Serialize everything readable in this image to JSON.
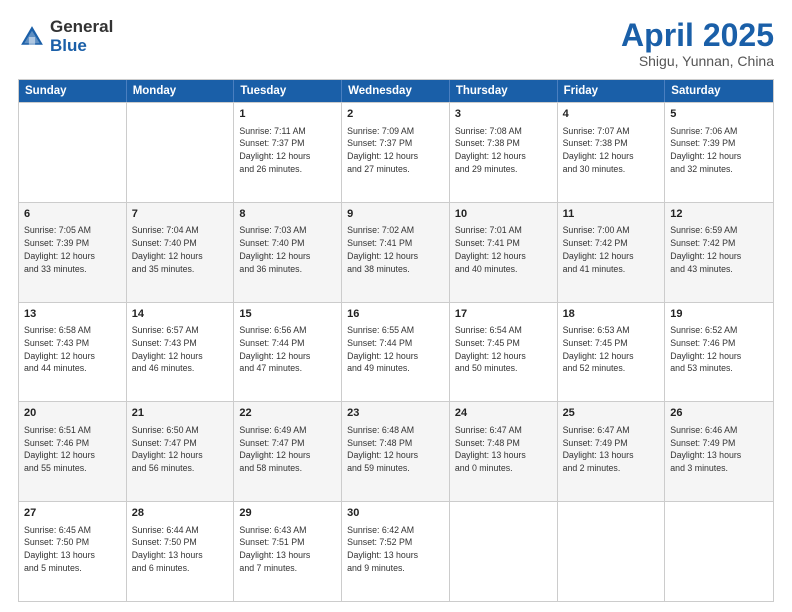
{
  "logo": {
    "general": "General",
    "blue": "Blue"
  },
  "title": {
    "month": "April 2025",
    "location": "Shigu, Yunnan, China"
  },
  "header_days": [
    "Sunday",
    "Monday",
    "Tuesday",
    "Wednesday",
    "Thursday",
    "Friday",
    "Saturday"
  ],
  "rows": [
    {
      "alt": false,
      "cells": [
        {
          "day": "",
          "text": ""
        },
        {
          "day": "",
          "text": ""
        },
        {
          "day": "1",
          "text": "Sunrise: 7:11 AM\nSunset: 7:37 PM\nDaylight: 12 hours\nand 26 minutes."
        },
        {
          "day": "2",
          "text": "Sunrise: 7:09 AM\nSunset: 7:37 PM\nDaylight: 12 hours\nand 27 minutes."
        },
        {
          "day": "3",
          "text": "Sunrise: 7:08 AM\nSunset: 7:38 PM\nDaylight: 12 hours\nand 29 minutes."
        },
        {
          "day": "4",
          "text": "Sunrise: 7:07 AM\nSunset: 7:38 PM\nDaylight: 12 hours\nand 30 minutes."
        },
        {
          "day": "5",
          "text": "Sunrise: 7:06 AM\nSunset: 7:39 PM\nDaylight: 12 hours\nand 32 minutes."
        }
      ]
    },
    {
      "alt": true,
      "cells": [
        {
          "day": "6",
          "text": "Sunrise: 7:05 AM\nSunset: 7:39 PM\nDaylight: 12 hours\nand 33 minutes."
        },
        {
          "day": "7",
          "text": "Sunrise: 7:04 AM\nSunset: 7:40 PM\nDaylight: 12 hours\nand 35 minutes."
        },
        {
          "day": "8",
          "text": "Sunrise: 7:03 AM\nSunset: 7:40 PM\nDaylight: 12 hours\nand 36 minutes."
        },
        {
          "day": "9",
          "text": "Sunrise: 7:02 AM\nSunset: 7:41 PM\nDaylight: 12 hours\nand 38 minutes."
        },
        {
          "day": "10",
          "text": "Sunrise: 7:01 AM\nSunset: 7:41 PM\nDaylight: 12 hours\nand 40 minutes."
        },
        {
          "day": "11",
          "text": "Sunrise: 7:00 AM\nSunset: 7:42 PM\nDaylight: 12 hours\nand 41 minutes."
        },
        {
          "day": "12",
          "text": "Sunrise: 6:59 AM\nSunset: 7:42 PM\nDaylight: 12 hours\nand 43 minutes."
        }
      ]
    },
    {
      "alt": false,
      "cells": [
        {
          "day": "13",
          "text": "Sunrise: 6:58 AM\nSunset: 7:43 PM\nDaylight: 12 hours\nand 44 minutes."
        },
        {
          "day": "14",
          "text": "Sunrise: 6:57 AM\nSunset: 7:43 PM\nDaylight: 12 hours\nand 46 minutes."
        },
        {
          "day": "15",
          "text": "Sunrise: 6:56 AM\nSunset: 7:44 PM\nDaylight: 12 hours\nand 47 minutes."
        },
        {
          "day": "16",
          "text": "Sunrise: 6:55 AM\nSunset: 7:44 PM\nDaylight: 12 hours\nand 49 minutes."
        },
        {
          "day": "17",
          "text": "Sunrise: 6:54 AM\nSunset: 7:45 PM\nDaylight: 12 hours\nand 50 minutes."
        },
        {
          "day": "18",
          "text": "Sunrise: 6:53 AM\nSunset: 7:45 PM\nDaylight: 12 hours\nand 52 minutes."
        },
        {
          "day": "19",
          "text": "Sunrise: 6:52 AM\nSunset: 7:46 PM\nDaylight: 12 hours\nand 53 minutes."
        }
      ]
    },
    {
      "alt": true,
      "cells": [
        {
          "day": "20",
          "text": "Sunrise: 6:51 AM\nSunset: 7:46 PM\nDaylight: 12 hours\nand 55 minutes."
        },
        {
          "day": "21",
          "text": "Sunrise: 6:50 AM\nSunset: 7:47 PM\nDaylight: 12 hours\nand 56 minutes."
        },
        {
          "day": "22",
          "text": "Sunrise: 6:49 AM\nSunset: 7:47 PM\nDaylight: 12 hours\nand 58 minutes."
        },
        {
          "day": "23",
          "text": "Sunrise: 6:48 AM\nSunset: 7:48 PM\nDaylight: 12 hours\nand 59 minutes."
        },
        {
          "day": "24",
          "text": "Sunrise: 6:47 AM\nSunset: 7:48 PM\nDaylight: 13 hours\nand 0 minutes."
        },
        {
          "day": "25",
          "text": "Sunrise: 6:47 AM\nSunset: 7:49 PM\nDaylight: 13 hours\nand 2 minutes."
        },
        {
          "day": "26",
          "text": "Sunrise: 6:46 AM\nSunset: 7:49 PM\nDaylight: 13 hours\nand 3 minutes."
        }
      ]
    },
    {
      "alt": false,
      "cells": [
        {
          "day": "27",
          "text": "Sunrise: 6:45 AM\nSunset: 7:50 PM\nDaylight: 13 hours\nand 5 minutes."
        },
        {
          "day": "28",
          "text": "Sunrise: 6:44 AM\nSunset: 7:50 PM\nDaylight: 13 hours\nand 6 minutes."
        },
        {
          "day": "29",
          "text": "Sunrise: 6:43 AM\nSunset: 7:51 PM\nDaylight: 13 hours\nand 7 minutes."
        },
        {
          "day": "30",
          "text": "Sunrise: 6:42 AM\nSunset: 7:52 PM\nDaylight: 13 hours\nand 9 minutes."
        },
        {
          "day": "",
          "text": ""
        },
        {
          "day": "",
          "text": ""
        },
        {
          "day": "",
          "text": ""
        }
      ]
    }
  ]
}
